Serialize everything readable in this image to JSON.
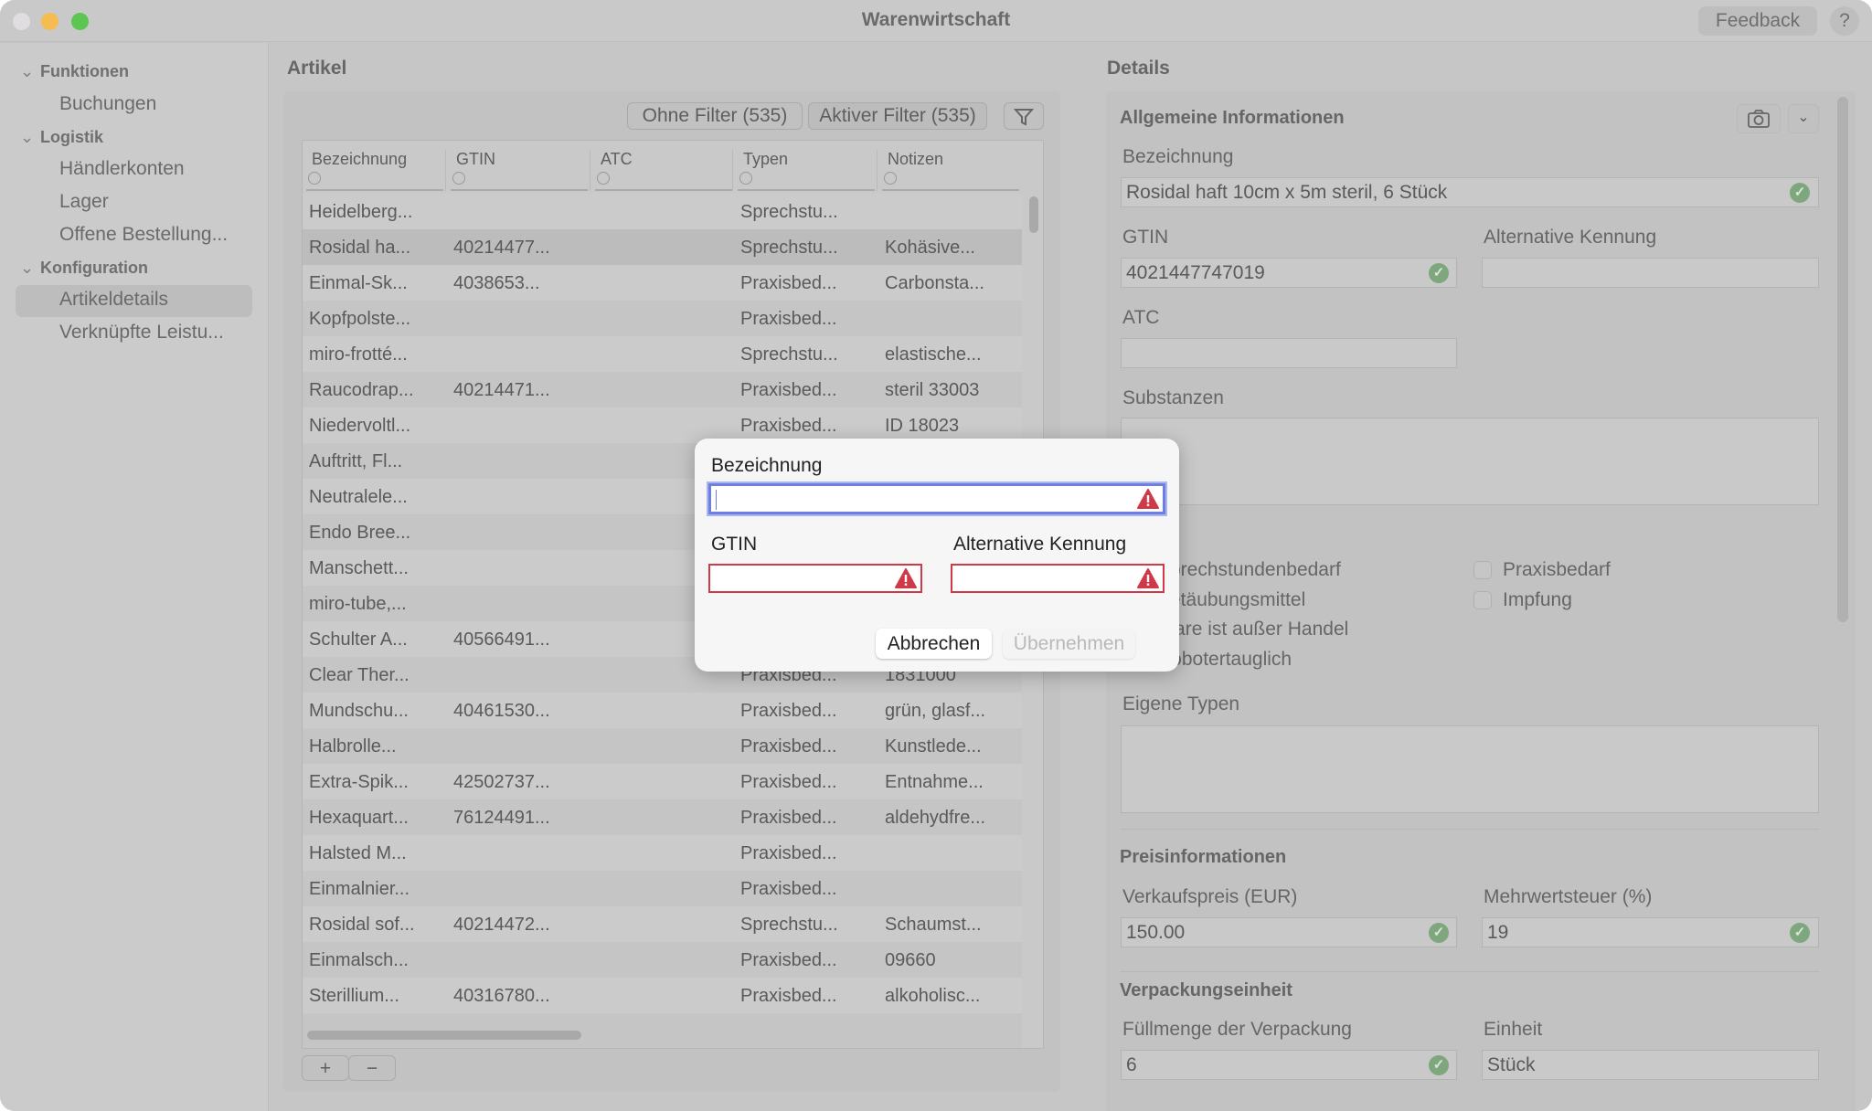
{
  "window": {
    "title": "Warenwirtschaft",
    "feedback": "Feedback",
    "help": "?"
  },
  "sidebar": {
    "sections": [
      {
        "label": "Funktionen",
        "items": [
          "Buchungen"
        ]
      },
      {
        "label": "Logistik",
        "items": [
          "Händlerkonten",
          "Lager",
          "Offene Bestellung..."
        ]
      },
      {
        "label": "Konfiguration",
        "items": [
          "Artikeldetails",
          "Verknüpfte Leistu..."
        ]
      }
    ],
    "selected": "Artikeldetails"
  },
  "artikel": {
    "title": "Artikel",
    "filter_none": "Ohne Filter (535)",
    "filter_active": "Aktiver Filter (535)",
    "columns": [
      "Bezeichnung",
      "GTIN",
      "ATC",
      "Typen",
      "Notizen"
    ],
    "rows": [
      [
        "Heidelberg...",
        "",
        "",
        "Sprechstu...",
        ""
      ],
      [
        "Rosidal ha...",
        "40214477...",
        "",
        "Sprechstu...",
        "Kohäsive..."
      ],
      [
        "Einmal-Sk...",
        "4038653...",
        "",
        "Praxisbed...",
        "Carbonsta..."
      ],
      [
        "Kopfpolste...",
        "",
        "",
        "Praxisbed...",
        ""
      ],
      [
        "miro-frotté...",
        "",
        "",
        "Sprechstu...",
        "elastische..."
      ],
      [
        "Raucodrap...",
        "40214471...",
        "",
        "Praxisbed...",
        "steril 33003"
      ],
      [
        "Niedervoltl...",
        "",
        "",
        "Praxisbed...",
        "ID 18023"
      ],
      [
        "Auftritt, Fl...",
        "",
        "",
        "",
        ""
      ],
      [
        "Neutralele...",
        "",
        "",
        "",
        ""
      ],
      [
        "Endo Bree...",
        "",
        "",
        "",
        ""
      ],
      [
        "Manschett...",
        "",
        "",
        "",
        ""
      ],
      [
        "miro-tube,...",
        "",
        "",
        "",
        ""
      ],
      [
        "Schulter A...",
        "40566491...",
        "",
        "",
        ""
      ],
      [
        "Clear Ther...",
        "",
        "",
        "Praxisbed...",
        "1831000"
      ],
      [
        "Mundschu...",
        "40461530...",
        "",
        "Praxisbed...",
        "grün, glasf..."
      ],
      [
        "Halbrolle...",
        "",
        "",
        "Praxisbed...",
        "Kunstlede..."
      ],
      [
        "Extra-Spik...",
        "42502737...",
        "",
        "Praxisbed...",
        "Entnahme..."
      ],
      [
        "Hexaquart...",
        "76124491...",
        "",
        "Praxisbed...",
        "aldehydfre..."
      ],
      [
        "Halsted M...",
        "",
        "",
        "Praxisbed...",
        ""
      ],
      [
        "Einmalnier...",
        "",
        "",
        "Praxisbed...",
        ""
      ],
      [
        "Rosidal sof...",
        "40214472...",
        "",
        "Sprechstu...",
        "Schaumst..."
      ],
      [
        "Einmalsch...",
        "",
        "",
        "Praxisbed...",
        "09660"
      ],
      [
        "Sterillium...",
        "40316780...",
        "",
        "Praxisbed...",
        "alkoholisc..."
      ]
    ],
    "selected_row": 1,
    "add": "+",
    "remove": "−"
  },
  "details": {
    "title": "Details",
    "general": "Allgemeine Informationen",
    "bezeichnung_label": "Bezeichnung",
    "bezeichnung": "Rosidal haft 10cm x 5m steril,  6 Stück",
    "gtin_label": "GTIN",
    "gtin": "4021447747019",
    "alt_label": "Alternative Kennung",
    "alt": "",
    "atc_label": "ATC",
    "atc": "",
    "substanzen_label": "Substanzen",
    "checkboxes": [
      {
        "label": "Sprechstundenbedarf",
        "checked": false
      },
      {
        "label": "Praxisbedarf",
        "checked": false
      },
      {
        "label": "Betäubungsmittel",
        "checked": false
      },
      {
        "label": "Impfung",
        "checked": false
      },
      {
        "label": "Ware ist außer Handel",
        "checked": false
      },
      {
        "label": "Robotertauglich",
        "checked": false
      }
    ],
    "eigene_typen_label": "Eigene Typen",
    "preis": "Preisinformationen",
    "vk_label": "Verkaufspreis (EUR)",
    "vk": "150.00",
    "mwst_label": "Mehrwertsteuer (%)",
    "mwst": "19",
    "verpackung": "Verpackungseinheit",
    "fuell_label": "Füllmenge der Verpackung",
    "fuell": "6",
    "einheit_label": "Einheit",
    "einheit": "Stück"
  },
  "dialog": {
    "bezeichnung_label": "Bezeichnung",
    "bezeichnung": "",
    "gtin_label": "GTIN",
    "gtin": "",
    "alt_label": "Alternative Kennung",
    "alt": "",
    "cancel": "Abbrechen",
    "apply": "Übernehmen",
    "error_color": "#d03a48",
    "focus_color": "#6f7fe0"
  },
  "colors": {
    "valid": "#7ea77e",
    "close": "#e0dde0",
    "minimize": "#f5bd4f",
    "zoom": "#5bc650"
  }
}
